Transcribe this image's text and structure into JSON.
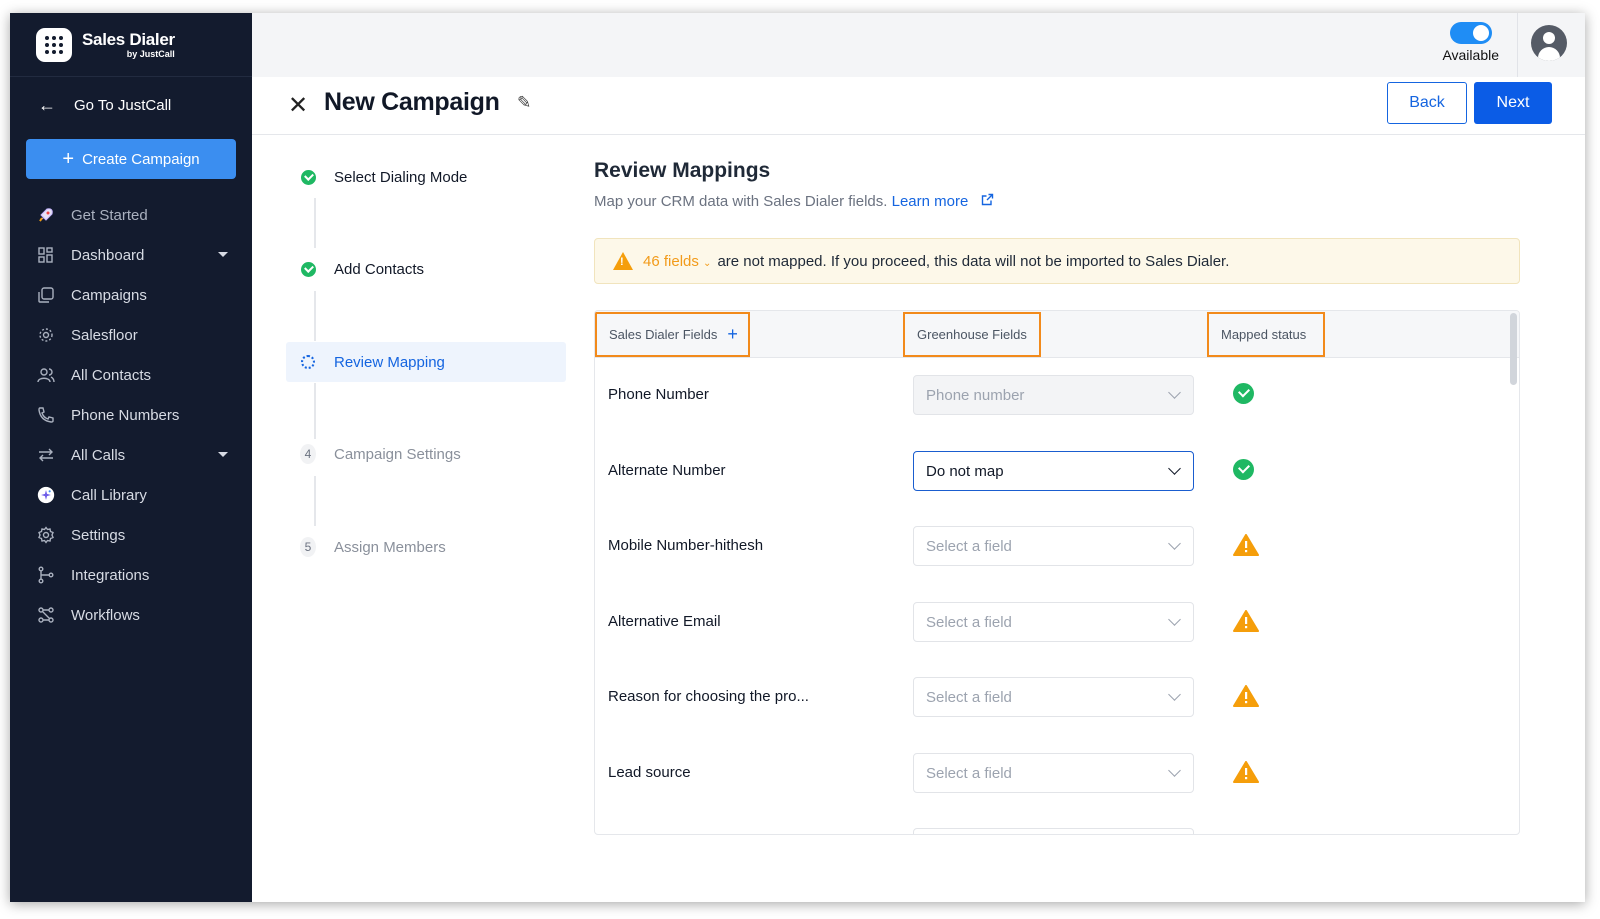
{
  "brand": {
    "name": "Sales Dialer",
    "sub": "by JustCall"
  },
  "sidebar": {
    "goto_label": "Go To JustCall",
    "create_label": "Create Campaign",
    "items": [
      {
        "label": "Get Started",
        "icon": "rocket-icon"
      },
      {
        "label": "Dashboard",
        "icon": "grid-icon"
      },
      {
        "label": "Campaigns",
        "icon": "campaign-icon"
      },
      {
        "label": "Salesfloor",
        "icon": "target-icon"
      },
      {
        "label": "All Contacts",
        "icon": "contacts-icon"
      },
      {
        "label": "Phone Numbers",
        "icon": "phone-icon"
      },
      {
        "label": "All Calls",
        "icon": "arrows-icon"
      },
      {
        "label": "Call Library",
        "icon": "sparkle-icon"
      },
      {
        "label": "Settings",
        "icon": "gear-icon"
      },
      {
        "label": "Integrations",
        "icon": "integrations-icon"
      },
      {
        "label": "Workflows",
        "icon": "workflow-icon"
      }
    ]
  },
  "topbar": {
    "status_label": "Available"
  },
  "header": {
    "title": "New Campaign",
    "back_label": "Back",
    "next_label": "Next"
  },
  "steps": [
    {
      "label": "Select Dialing Mode",
      "state": "done"
    },
    {
      "label": "Add Contacts",
      "state": "done"
    },
    {
      "label": "Review Mapping",
      "state": "active"
    },
    {
      "label": "Campaign Settings",
      "state": "pending",
      "num": "4"
    },
    {
      "label": "Assign Members",
      "state": "pending",
      "num": "5"
    }
  ],
  "main": {
    "title": "Review Mappings",
    "subtitle": "Map your CRM data with Sales Dialer fields.",
    "learn_more": "Learn more",
    "warning_count": "46 fields",
    "warning_text": "are not mapped. If you proceed, this data will not be imported to Sales Dialer.",
    "columns": [
      "Sales Dialer Fields",
      "Greenhouse Fields",
      "Mapped status"
    ],
    "rows": [
      {
        "field": "Phone Number",
        "mapping": "Phone number",
        "status": "mapped"
      },
      {
        "field": "Alternate Number",
        "mapping": "Do not map",
        "status": "mapped"
      },
      {
        "field": "Mobile Number-hithesh",
        "mapping": "Select a field",
        "status": "warning"
      },
      {
        "field": "Alternative Email",
        "mapping": "Select a field",
        "status": "warning"
      },
      {
        "field": "Reason for choosing the pro...",
        "mapping": "Select a field",
        "status": "warning"
      },
      {
        "field": "Lead source",
        "mapping": "Select a field",
        "status": "warning"
      }
    ]
  },
  "colors": {
    "sidebar_bg": "#131b2e",
    "primary": "#0b5ce6",
    "accent_orange": "#f28a1b",
    "success": "#1fb863",
    "warning": "#f59e0b"
  }
}
